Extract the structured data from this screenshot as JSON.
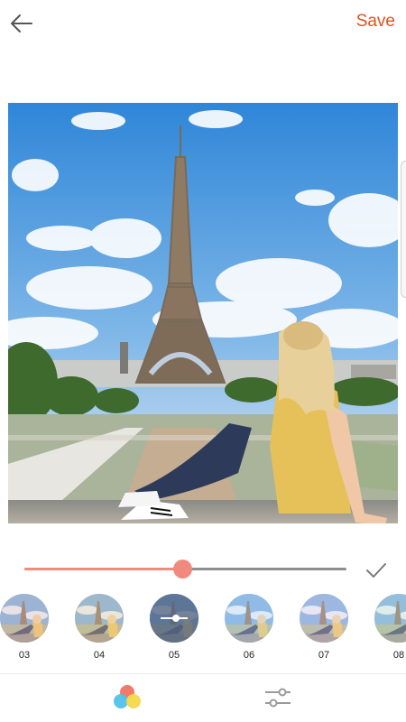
{
  "header": {
    "back_icon": "arrow-left-icon",
    "save_label": "Save",
    "save_color": "#e0521f"
  },
  "photo": {
    "description_icon": "photo-preview"
  },
  "slider": {
    "value": 0.49,
    "track_color": "#8f8f8f",
    "fill_color": "#f08a7e",
    "confirm_icon": "check-icon"
  },
  "filters": [
    {
      "label": "03",
      "kind": "photo",
      "tint": "#f3c9c0",
      "selected": false
    },
    {
      "label": "04",
      "kind": "photo",
      "tint": "#f7d6a8",
      "selected": false
    },
    {
      "label": "05",
      "kind": "adjust",
      "tint": "#5a6a84",
      "selected": true
    },
    {
      "label": "06",
      "kind": "photo",
      "tint": "#cfe0f5",
      "selected": false
    },
    {
      "label": "07",
      "kind": "photo",
      "tint": "#f2d8e6",
      "selected": false
    },
    {
      "label": "08",
      "kind": "photo",
      "tint": "#d9e8d4",
      "selected": false
    }
  ],
  "bottom_nav": [
    {
      "icon": "filters-icon",
      "active": true
    },
    {
      "icon": "adjust-sliders-icon",
      "active": false
    }
  ]
}
